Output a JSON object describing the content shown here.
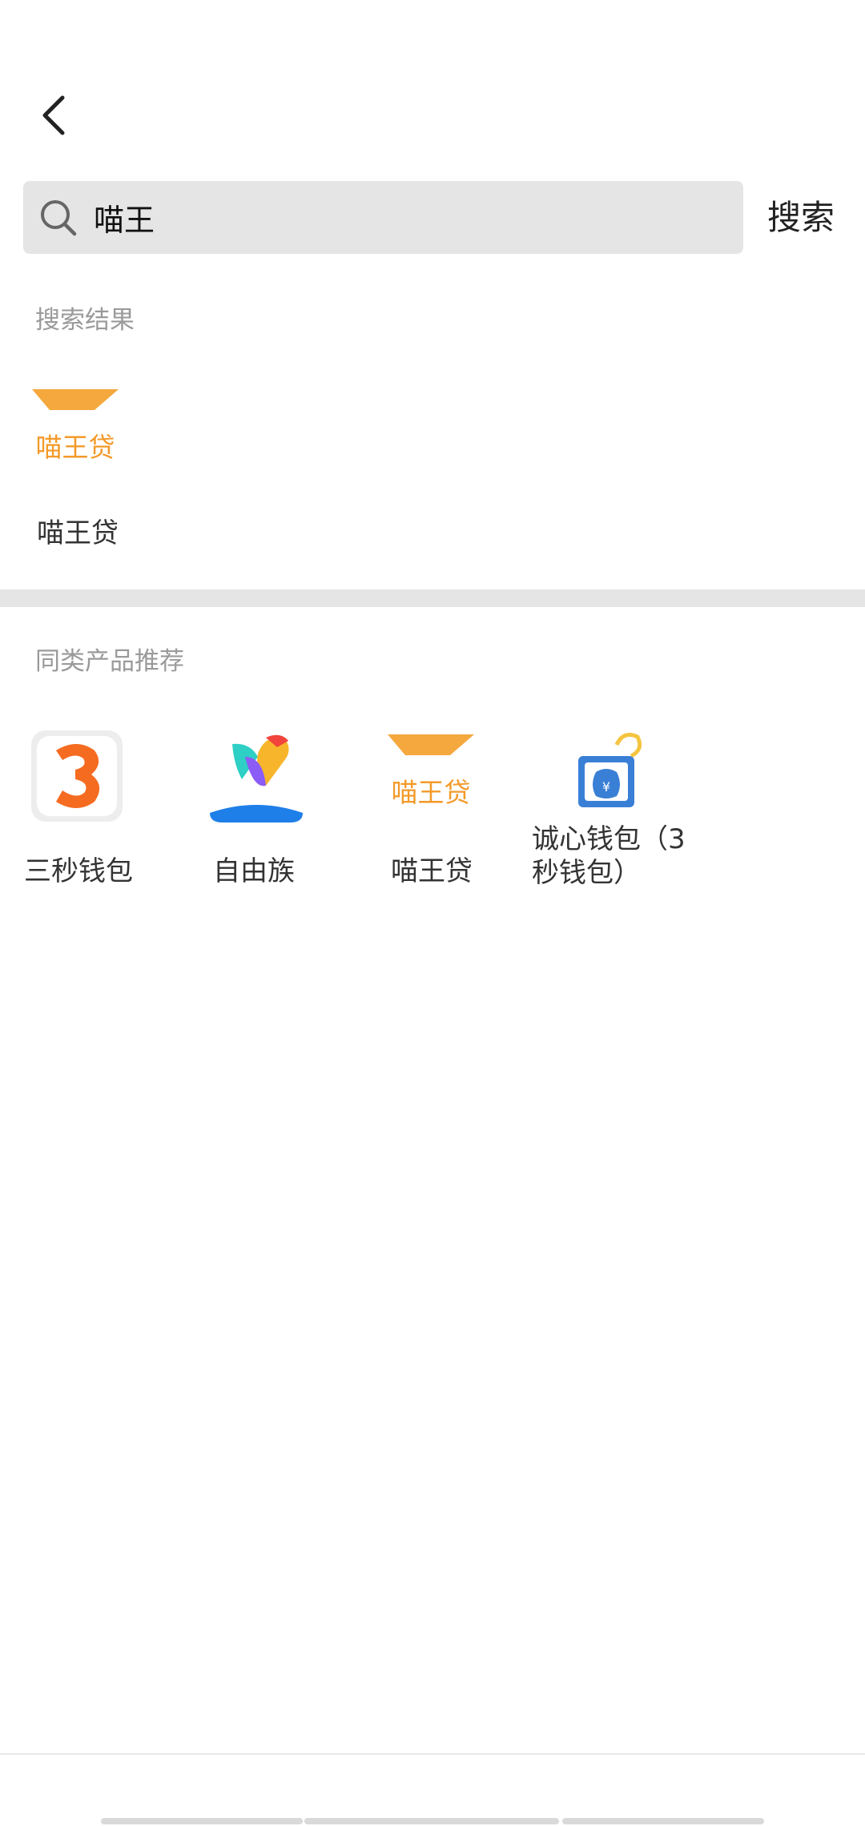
{
  "search": {
    "value": "喵王",
    "submit_label": "搜索"
  },
  "results": {
    "section_title": "搜索结果",
    "items": [
      {
        "name": "喵王贷",
        "icon": "miaowang-logo"
      }
    ]
  },
  "recommend": {
    "section_title": "同类产品推荐",
    "items": [
      {
        "name": "三秒钱包",
        "icon": "three-logo"
      },
      {
        "name": "自由族",
        "icon": "parrot-logo"
      },
      {
        "name": "喵王贷",
        "icon": "miaowang-logo"
      },
      {
        "name_line1": "诚心钱包（3",
        "name_line2": "秒钱包）",
        "icon": "money-bag-logo"
      }
    ]
  },
  "logo_text": "喵王贷",
  "colors": {
    "brand_orange": "#f4a83d",
    "text_gray": "#9a9a9a",
    "blue": "#1f7fe8"
  }
}
